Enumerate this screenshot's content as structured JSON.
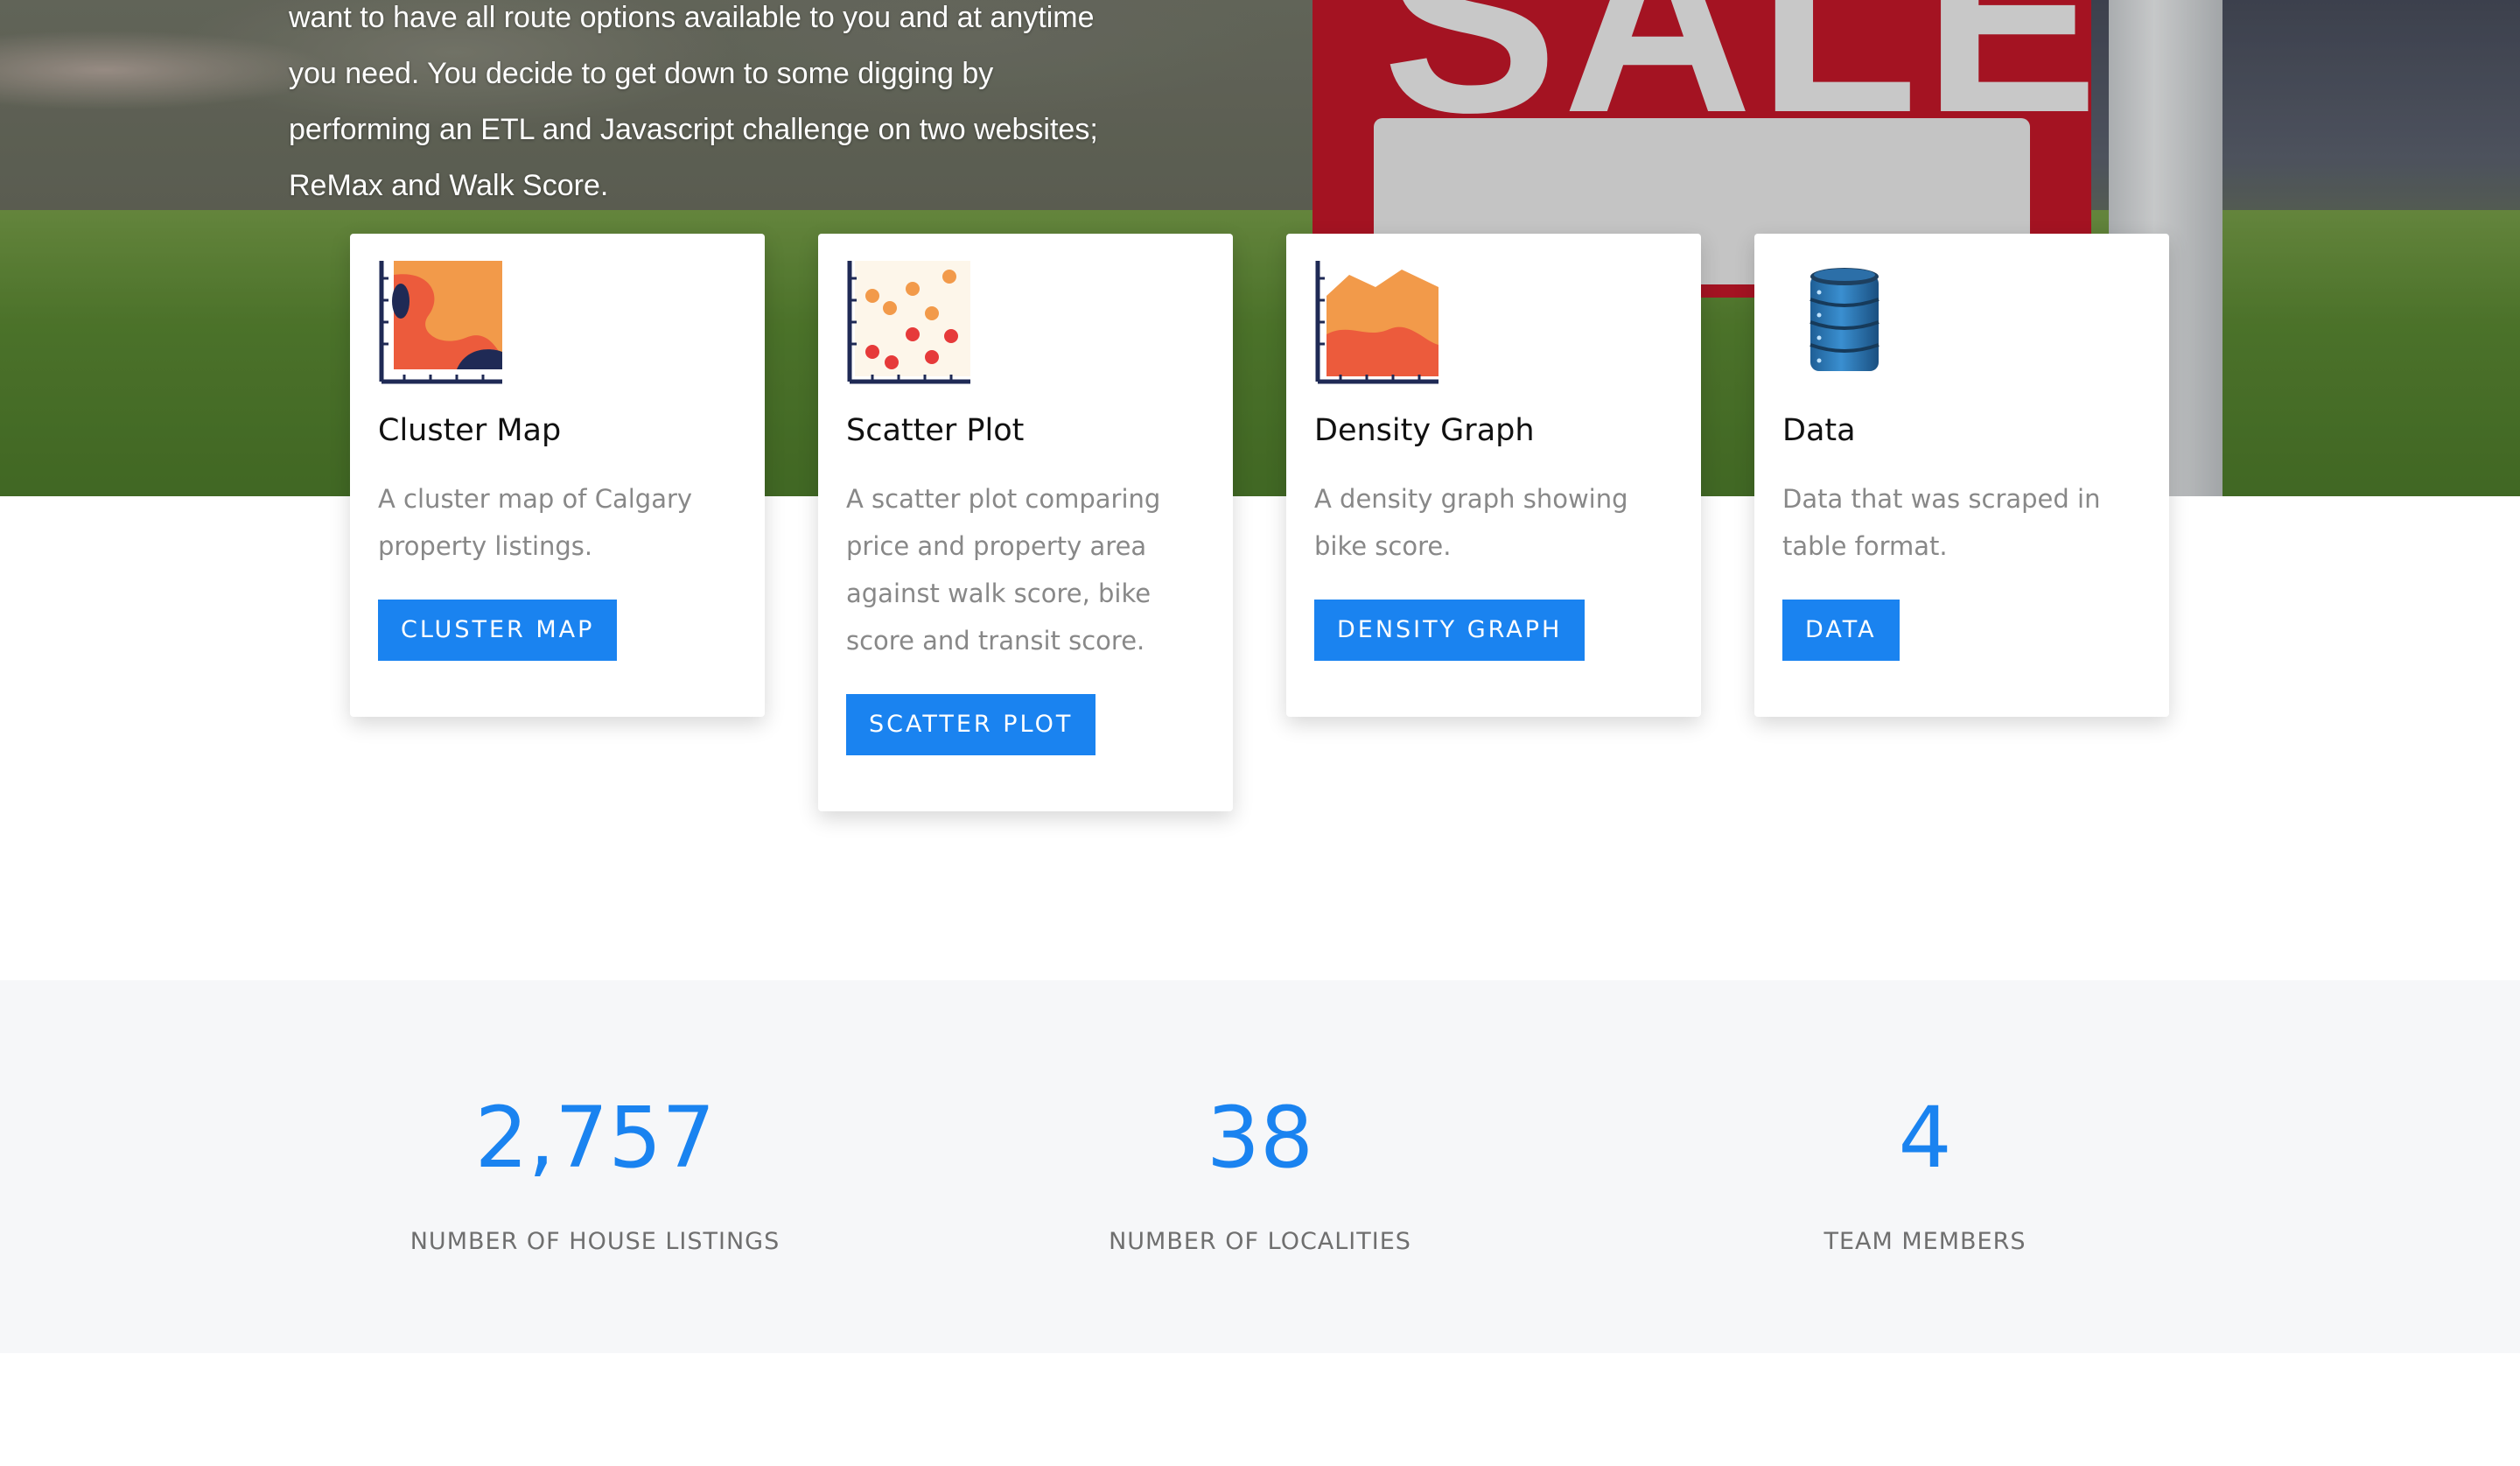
{
  "hero": {
    "intro_lines": [
      "want to have all route options available to you and at anytime",
      "you need. You decide to get down to some digging by",
      "performing an ETL and Javascript challenge on two websites;",
      "ReMax and Walk Score."
    ],
    "sign_text": "SALE"
  },
  "cards": [
    {
      "title": "Cluster Map",
      "description": "A cluster map of Calgary property listings.",
      "button": "CLUSTER MAP",
      "icon": "cluster-map-icon"
    },
    {
      "title": "Scatter Plot",
      "description": "A scatter plot comparing price and property area against walk score, bike score and transit score.",
      "button": "SCATTER PLOT",
      "icon": "scatter-plot-icon"
    },
    {
      "title": "Density Graph",
      "description": "A density graph showing bike score.",
      "button": "DENSITY GRAPH",
      "icon": "density-graph-icon"
    },
    {
      "title": "Data",
      "description": "Data that was scraped in table format.",
      "button": "DATA",
      "icon": "database-icon"
    }
  ],
  "stats": [
    {
      "number": "2,757",
      "label": "NUMBER OF HOUSE LISTINGS"
    },
    {
      "number": "38",
      "label": "NUMBER OF LOCALITIES"
    },
    {
      "number": "4",
      "label": "TEAM MEMBERS"
    }
  ],
  "colors": {
    "accent": "#1a83f0",
    "card_title": "#111111",
    "card_text": "#888888",
    "stats_background": "#f6f7f9",
    "sign_red": "#c8182a"
  }
}
